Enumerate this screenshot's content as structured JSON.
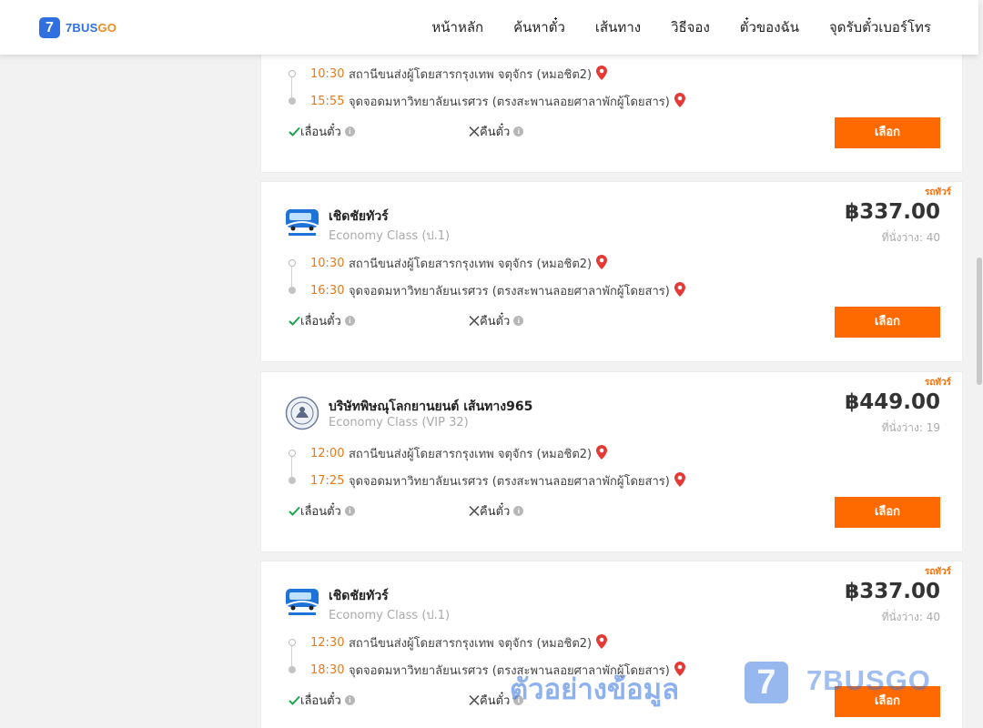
{
  "brand": {
    "mark": "7",
    "name_a": "7BUS",
    "name_b": "GO"
  },
  "nav": {
    "items": [
      "หน้าหลัก",
      "ค้นหาตั๋ว",
      "เส้นทาง",
      "วิธีจอง",
      "ตั๋วของฉัน",
      "จุดรับตั๋วเบอร์โทร"
    ]
  },
  "colors": {
    "accent": "#ff6a00",
    "brand_blue": "#2f6fe0",
    "time": "#e87a1a",
    "pin": "#e53935"
  },
  "labels": {
    "reschedule": "เลื่อนตั๋ว",
    "refund": "คืนตั๋ว",
    "select": "เลือก",
    "bus_tag": "รถทัวร์",
    "info_icon": "i"
  },
  "trips": [
    {
      "partial": true,
      "depart_time": "10:30",
      "depart_place": "สถานีขนส่งผู้โดยสารกรุงเทพ จตุจักร (หมอชิต2)",
      "arrive_time": "15:55",
      "arrive_place": "จุดจอดมหาวิทยาลัยนเรศวร (ตรงสะพานลอยศาลาพักผู้โดยสาร)"
    },
    {
      "operator": "เชิดชัยทัวร์",
      "class": "Economy Class (ป.1)",
      "price": "฿337.00",
      "seats": "ที่นั่งว่าง: 40",
      "depart_time": "10:30",
      "depart_place": "สถานีขนส่งผู้โดยสารกรุงเทพ จตุจักร (หมอชิต2)",
      "arrive_time": "16:30",
      "arrive_place": "จุดจอดมหาวิทยาลัยนเรศวร (ตรงสะพานลอยศาลาพักผู้โดยสาร)"
    },
    {
      "operator": "บริษัทพิษณุโลกยานยนต์ เส้นทาง965",
      "class": "Economy Class (VIP 32)",
      "price": "฿449.00",
      "seats": "ที่นั่งว่าง: 19",
      "depart_time": "12:00",
      "depart_place": "สถานีขนส่งผู้โดยสารกรุงเทพ จตุจักร (หมอชิต2)",
      "arrive_time": "17:25",
      "arrive_place": "จุดจอดมหาวิทยาลัยนเรศวร (ตรงสะพานลอยศาลาพักผู้โดยสาร)"
    },
    {
      "operator": "เชิดชัยทัวร์",
      "class": "Economy Class (ป.1)",
      "price": "฿337.00",
      "seats": "ที่นั่งว่าง: 40",
      "depart_time": "12:30",
      "depart_place": "สถานีขนส่งผู้โดยสารกรุงเทพ จตุจักร (หมอชิต2)",
      "arrive_time": "18:30",
      "arrive_place": "จุดจอดมหาวิทยาลัยนเรศวร (ตรงสะพานลอยศาลาพักผู้โดยสาร)"
    }
  ],
  "watermark": {
    "text": "ตัวอย่างข้อมูล",
    "mark": "7",
    "brand": "7BUSGO"
  }
}
